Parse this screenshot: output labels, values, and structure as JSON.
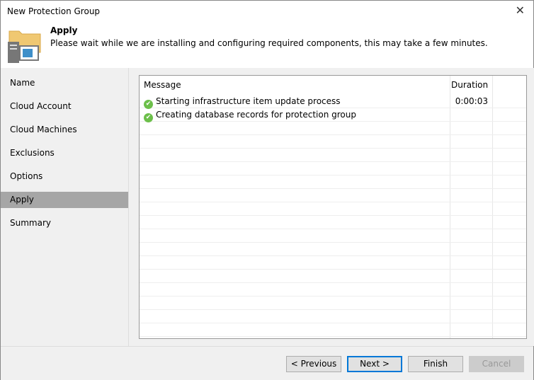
{
  "window": {
    "title": "New Protection Group"
  },
  "header": {
    "title": "Apply",
    "description": "Please wait while we are installing and configuring required components, this may take a few minutes."
  },
  "nav": {
    "items": [
      {
        "label": "Name"
      },
      {
        "label": "Cloud Account"
      },
      {
        "label": "Cloud Machines"
      },
      {
        "label": "Exclusions"
      },
      {
        "label": "Options"
      },
      {
        "label": "Apply",
        "selected": true
      },
      {
        "label": "Summary"
      }
    ]
  },
  "grid": {
    "columns": [
      "Message",
      "Duration"
    ],
    "rows": [
      {
        "message": "Starting infrastructure item update process",
        "duration": "0:00:03",
        "status": "success"
      },
      {
        "message": "Creating database records for protection group",
        "duration": "",
        "status": "success"
      }
    ]
  },
  "buttons": {
    "previous": "< Previous",
    "next": "Next >",
    "finish": "Finish",
    "cancel": "Cancel"
  }
}
